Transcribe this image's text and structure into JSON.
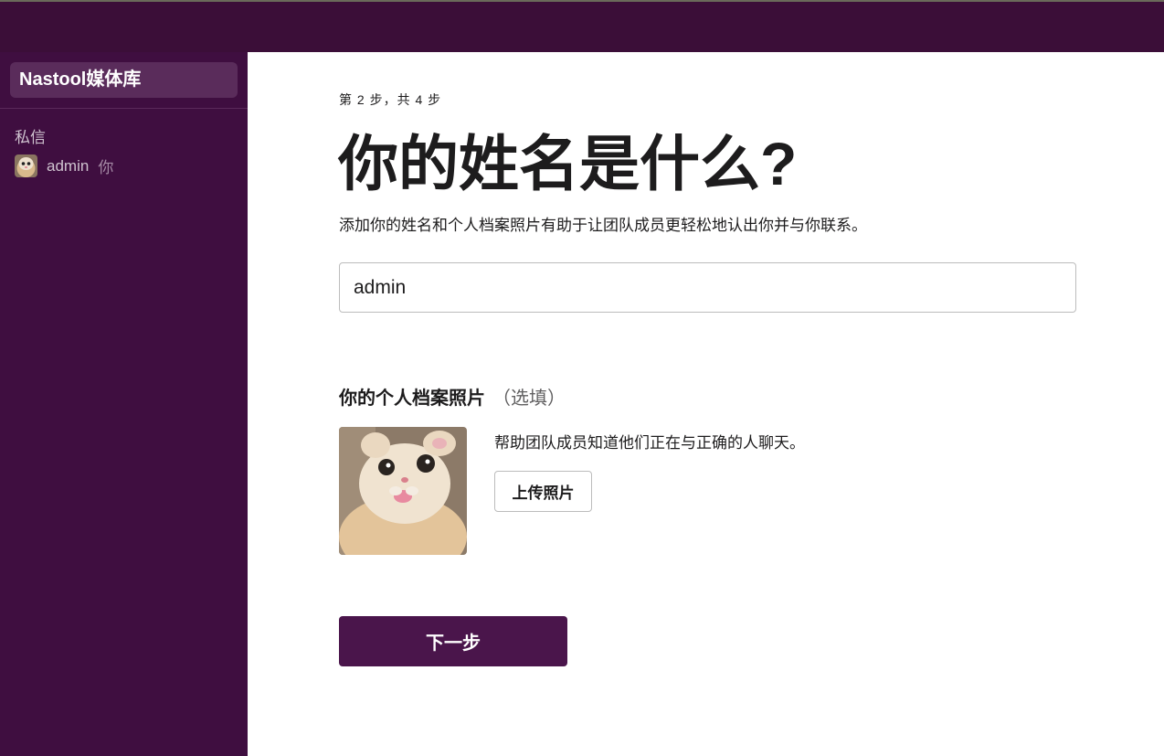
{
  "workspace": {
    "name": "Nastool媒体库"
  },
  "sidebar": {
    "section_label": "私信",
    "dm": {
      "name": "admin",
      "you_tag": "你",
      "avatar": "cat-avatar-icon"
    }
  },
  "main": {
    "step_text": "第 2 步，共 4 步",
    "title": "你的姓名是什么?",
    "subtitle": "添加你的姓名和个人档案照片有助于让团队成员更轻松地认出你并与你联系。",
    "name_input_value": "admin",
    "photo_heading": "你的个人档案照片",
    "photo_optional": "（选填）",
    "photo_help": "帮助团队成员知道他们正在与正确的人聊天。",
    "upload_label": "上传照片",
    "next_label": "下一步"
  },
  "colors": {
    "topbar": "#3b0e38",
    "sidebar": "#3f0e40",
    "primary_button": "#4a154b"
  }
}
